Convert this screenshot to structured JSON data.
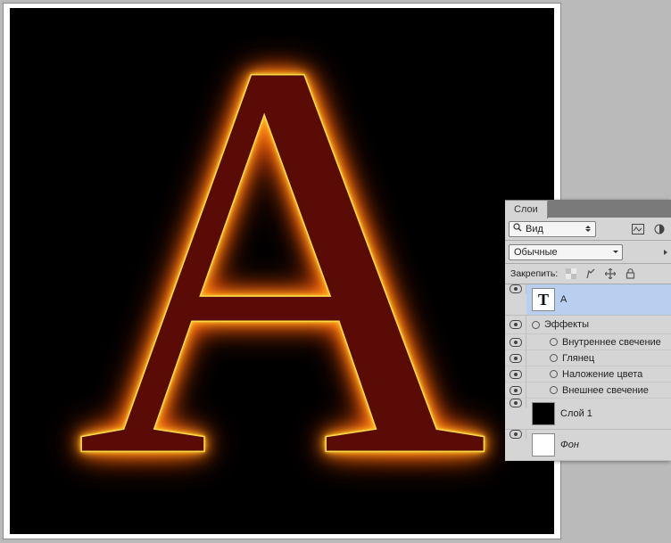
{
  "canvas": {
    "letter": "A"
  },
  "panel": {
    "tab": "Слои",
    "view_label": "Вид",
    "blend_mode": "Обычные",
    "lock_label": "Закрепить:"
  },
  "layers": [
    {
      "type": "text",
      "name": "A"
    },
    {
      "type": "solid",
      "name": "Слой 1",
      "fill": "black"
    },
    {
      "type": "bg",
      "name": "Фон",
      "fill": "white"
    }
  ],
  "effects": {
    "header": "Эффекты",
    "items": [
      "Внутреннее свечение",
      "Глянец",
      "Наложение цвета",
      "Внешнее свечение"
    ]
  }
}
